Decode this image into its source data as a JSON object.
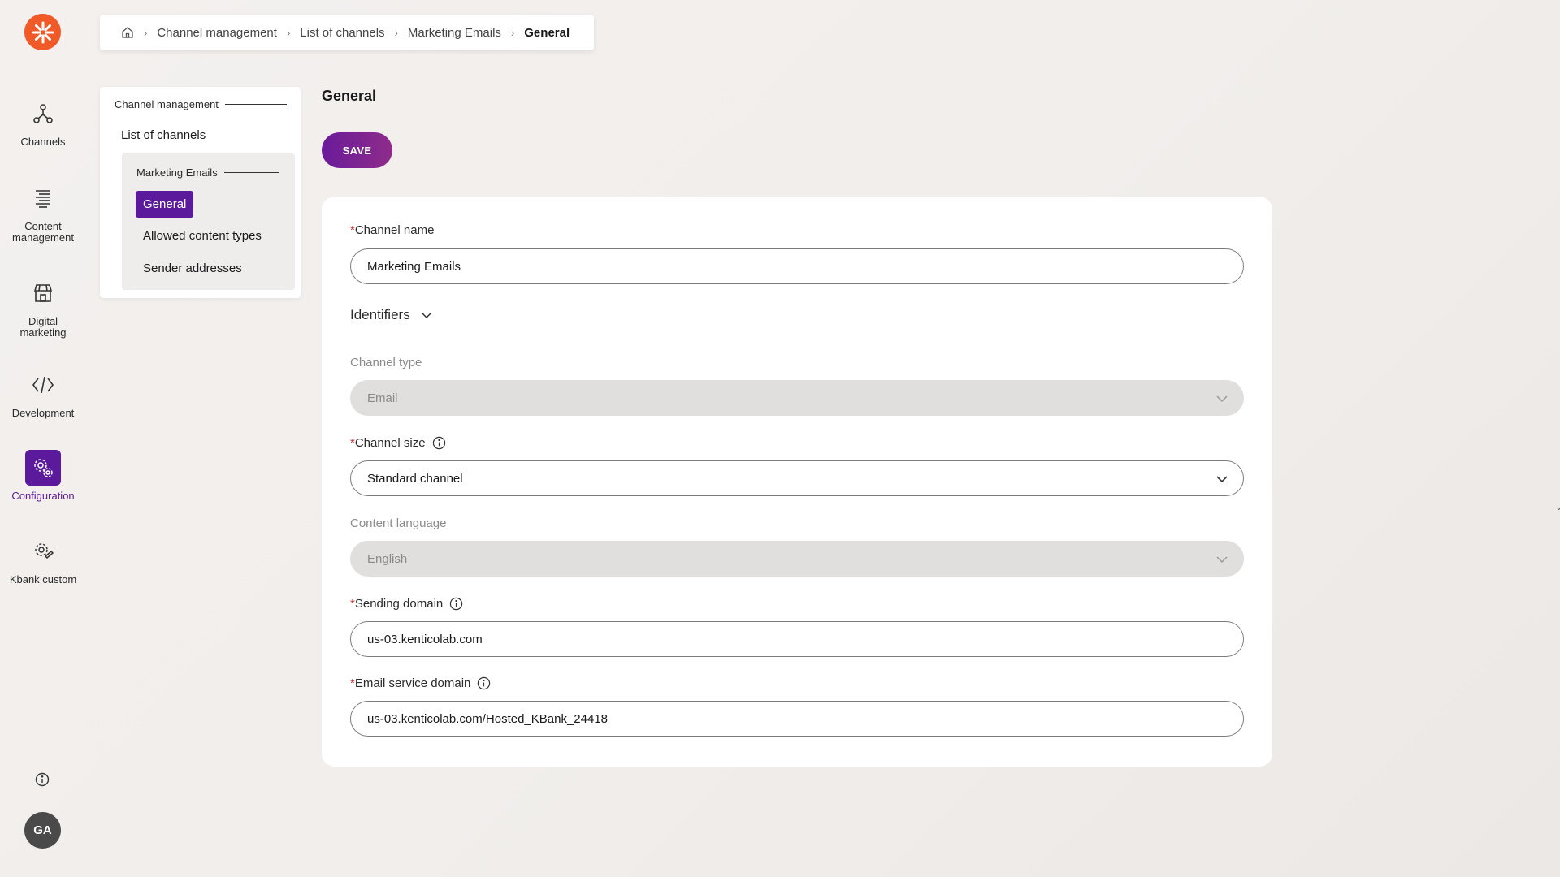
{
  "rail": {
    "items": [
      {
        "label": "Channels",
        "icon": "channels-icon"
      },
      {
        "label": "Content management",
        "icon": "content-management-icon"
      },
      {
        "label": "Digital marketing",
        "icon": "digital-marketing-icon"
      },
      {
        "label": "Development",
        "icon": "code-icon"
      },
      {
        "label": "Configuration",
        "icon": "configuration-icon",
        "active": true
      },
      {
        "label": "Kbank custom",
        "icon": "custom-icon"
      }
    ],
    "avatar_initials": "GA",
    "logo_color": "#f05a28",
    "accent_color": "#5b1a9c"
  },
  "breadcrumb": {
    "items": [
      "Channel management",
      "List of channels",
      "Marketing Emails",
      "General"
    ]
  },
  "subnav": {
    "group_title": "Channel management",
    "list_link": "List of channels",
    "inner_title": "Marketing Emails",
    "links": [
      "General",
      "Allowed content types",
      "Sender addresses"
    ],
    "active_link": "General"
  },
  "main": {
    "title": "General",
    "save_label": "SAVE",
    "fields": {
      "channel_name": {
        "label": "Channel name",
        "value": "Marketing Emails",
        "required": "*"
      },
      "identifiers_label": "Identifiers",
      "channel_type": {
        "label": "Channel type",
        "value": "Email"
      },
      "channel_size": {
        "label": "Channel size",
        "value": "Standard channel",
        "required": "*"
      },
      "content_language": {
        "label": "Content language",
        "value": "English"
      },
      "sending_domain": {
        "label": "Sending domain",
        "value": "us-03.kenticolab.com",
        "required": "*"
      },
      "email_service_domain": {
        "label": "Email service domain",
        "value": "us-03.kenticolab.com/Hosted_KBank_24418",
        "required": "*"
      }
    }
  }
}
